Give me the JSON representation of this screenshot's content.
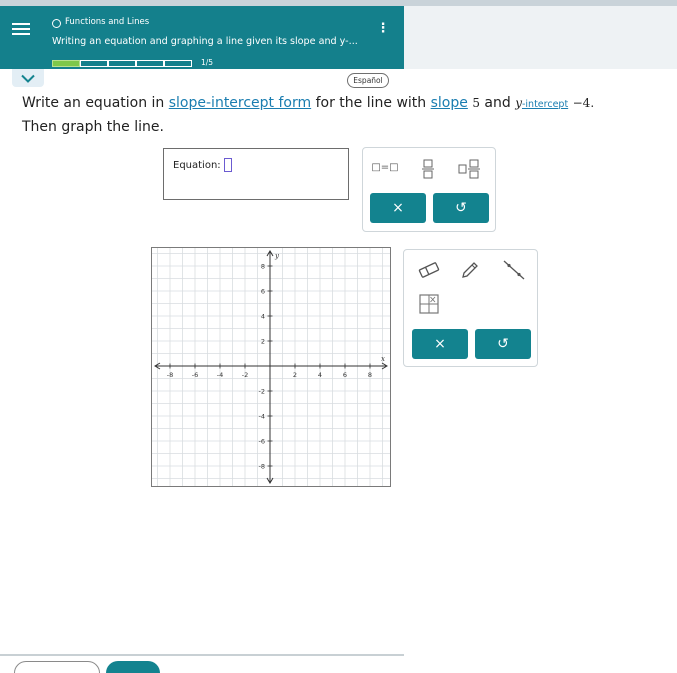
{
  "header": {
    "topic": "Functions and Lines",
    "title": "Writing an equation and graphing a line given its slope and y-...",
    "progress_count": "1/5",
    "progress_filled": 1,
    "progress_total": 5
  },
  "espanol_label": "Español",
  "question": {
    "part1": "Write an equation in ",
    "link1": "slope-intercept form",
    "part2": " for the line with ",
    "link2": "slope",
    "slope_value": "5",
    "part3": " and ",
    "y_letter": "y",
    "link3": "-intercept",
    "intercept_value": "−4.",
    "line2": "Then graph the line."
  },
  "equation": {
    "label": "Equation:"
  },
  "palette": {
    "eq_template": "□=□",
    "clear_symbol": "×",
    "undo_symbol": "↺"
  },
  "graph": {
    "x_axis_label": "x",
    "y_axis_label": "y",
    "x_ticks": [
      "-8",
      "-6",
      "-4",
      "-2",
      "2",
      "4",
      "6",
      "8"
    ],
    "y_ticks": [
      "8",
      "6",
      "4",
      "2",
      "-2",
      "-4",
      "-6",
      "-8"
    ]
  },
  "graph_tools": {
    "clear_symbol": "×",
    "undo_symbol": "↺"
  },
  "icons": {
    "menu": "hamburger-menu-icon",
    "kebab": "more-options-icon",
    "collapse": "chevron-down-icon",
    "eraser": "eraser-icon",
    "pencil": "pencil-icon",
    "line": "line-tool-icon",
    "table": "table-icon"
  },
  "colors": {
    "header_bg": "#14808c",
    "accent": "#13838f",
    "link": "#1a7db0",
    "progress_fill": "#7ec84a",
    "cursor_box": "#6b5bd1"
  }
}
